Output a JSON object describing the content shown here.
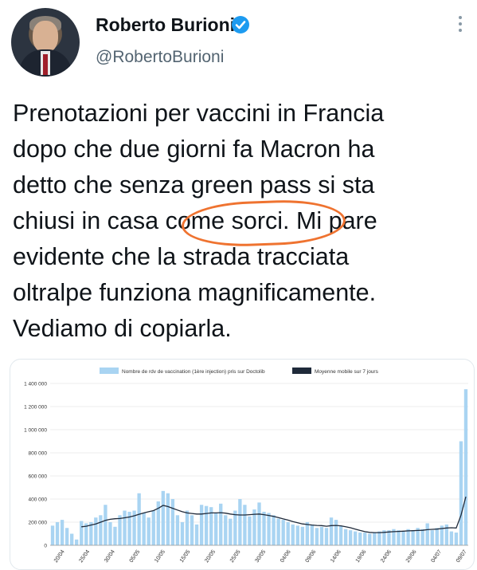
{
  "author": {
    "name": "Roberto Burioni",
    "handle": "@RobertoBurioni",
    "verified": true
  },
  "icons": [
    "avatar-photo",
    "verified-badge-icon",
    "more-options-icon"
  ],
  "tweet": {
    "lines": [
      "Prenotazioni per vaccini in Francia",
      "dopo che due giorni fa Macron ha",
      "detto che senza green pass si sta",
      "chiusi in casa come sorci. Mi pare",
      "evidente che la strada tracciata",
      "oltralpe funziona magnificamente.",
      "Vediamo di copiarla."
    ],
    "highlight_color": "#ef7330"
  },
  "chart_data": {
    "type": "bar",
    "legend_position": "top",
    "bar_color": "#a9d4f2",
    "line_color": "#1f2a3a",
    "y_ticks": [
      "0",
      "200 000",
      "400 000",
      "600 000",
      "800 000",
      "1 000 000",
      "1 200 000",
      "1 400 000"
    ],
    "ylim": [
      0,
      1400000
    ],
    "x_tick_labels": [
      "20/04",
      "25/04",
      "30/04",
      "05/05",
      "10/05",
      "15/05",
      "20/05",
      "25/05",
      "30/05",
      "04/06",
      "09/06",
      "14/06",
      "19/06",
      "24/06",
      "29/06",
      "04/07",
      "09/07"
    ],
    "series": [
      {
        "name": "Nombre de rdv de vaccination (1ère injection) pris sur Doctolib",
        "type": "bar",
        "values": [
          170000,
          200000,
          220000,
          150000,
          100000,
          50000,
          210000,
          190000,
          200000,
          240000,
          260000,
          350000,
          200000,
          160000,
          260000,
          300000,
          290000,
          300000,
          450000,
          280000,
          240000,
          300000,
          380000,
          470000,
          450000,
          400000,
          260000,
          200000,
          300000,
          260000,
          180000,
          350000,
          340000,
          330000,
          280000,
          360000,
          260000,
          230000,
          300000,
          400000,
          350000,
          250000,
          310000,
          370000,
          290000,
          280000,
          260000,
          230000,
          220000,
          200000,
          180000,
          170000,
          160000,
          200000,
          180000,
          150000,
          160000,
          150000,
          240000,
          220000,
          170000,
          140000,
          130000,
          120000,
          110000,
          110000,
          100000,
          110000,
          120000,
          130000,
          130000,
          140000,
          130000,
          120000,
          140000,
          130000,
          150000,
          140000,
          190000,
          130000,
          150000,
          170000,
          180000,
          120000,
          110000,
          900000,
          1350000
        ]
      },
      {
        "name": "Moyenne mobile sur 7 jours",
        "type": "line",
        "values": [
          null,
          null,
          null,
          null,
          null,
          null,
          160000,
          165000,
          175000,
          185000,
          200000,
          215000,
          225000,
          230000,
          232000,
          238000,
          245000,
          255000,
          268000,
          280000,
          290000,
          300000,
          320000,
          345000,
          335000,
          320000,
          305000,
          290000,
          280000,
          275000,
          270000,
          270000,
          275000,
          280000,
          280000,
          282000,
          278000,
          270000,
          265000,
          262000,
          262000,
          265000,
          268000,
          270000,
          265000,
          258000,
          250000,
          240000,
          228000,
          218000,
          205000,
          195000,
          185000,
          180000,
          175000,
          172000,
          170000,
          165000,
          170000,
          172000,
          168000,
          160000,
          152000,
          140000,
          128000,
          118000,
          112000,
          110000,
          110000,
          112000,
          115000,
          118000,
          120000,
          122000,
          125000,
          126000,
          128000,
          130000,
          135000,
          138000,
          140000,
          145000,
          150000,
          152000,
          150000,
          260000,
          420000
        ]
      }
    ]
  }
}
